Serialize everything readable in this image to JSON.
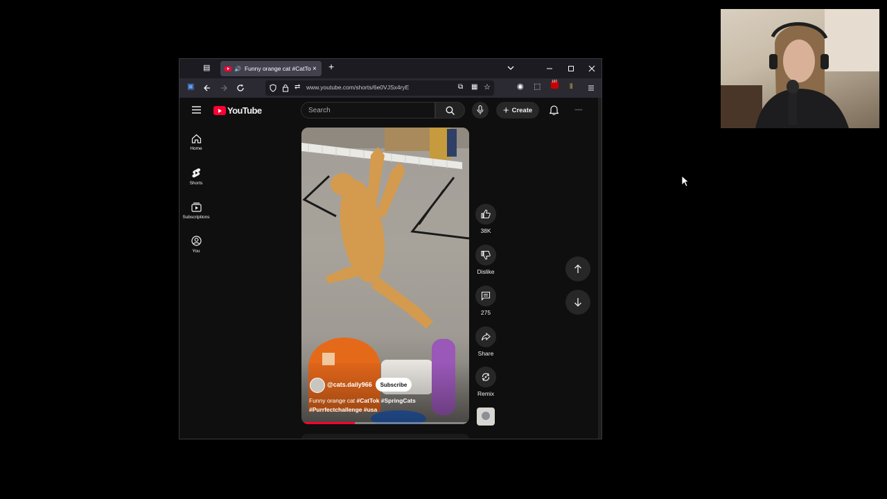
{
  "browser": {
    "tab": {
      "title": "Funny orange cat #CatTok",
      "close": "×"
    },
    "new_tab": "+",
    "url": "www.youtube.com/shorts/6e0VJSx4ryE",
    "extension_badge": "197"
  },
  "youtube": {
    "logo_text": "YouTube",
    "search_placeholder": "Search",
    "create_label": "Create",
    "create_plus": "+",
    "sidebar": [
      {
        "label": "Home"
      },
      {
        "label": "Shorts"
      },
      {
        "label": "Subscriptions"
      },
      {
        "label": "You"
      }
    ],
    "short": {
      "channel": "@cats.daily966",
      "subscribe_label": "Subscribe",
      "caption_plain": "Funny orange cat ",
      "hashtags_line1": "#CatTok #SpringCats",
      "hashtags_line2": "#Purrfectchallenge #usa",
      "progress": 0.32
    },
    "actions": {
      "likes": "38K",
      "dislike": "Dislike",
      "comments": "275",
      "share": "Share",
      "remix": "Remix"
    }
  },
  "colors": {
    "brand_red": "#ff0033",
    "page_bg": "#0f0f0f",
    "button_bg": "#272727"
  }
}
